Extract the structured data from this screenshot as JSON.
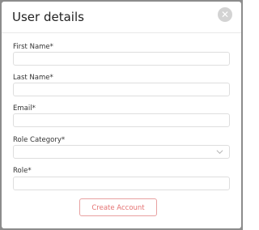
{
  "dialog": {
    "title": "User details",
    "close_icon": "close-icon"
  },
  "form": {
    "first_name": {
      "label": "First Name*",
      "value": ""
    },
    "last_name": {
      "label": "Last Name*",
      "value": ""
    },
    "email": {
      "label": "Email*",
      "value": ""
    },
    "role_category": {
      "label": "Role Category*",
      "selected": "",
      "icon": "chevron-down-icon"
    },
    "role": {
      "label": "Role*",
      "value": ""
    }
  },
  "actions": {
    "create_label": "Create Account"
  },
  "colors": {
    "accent": "#e57373",
    "accent_border": "#e8a0a0",
    "backdrop": "#8c8c8c"
  }
}
